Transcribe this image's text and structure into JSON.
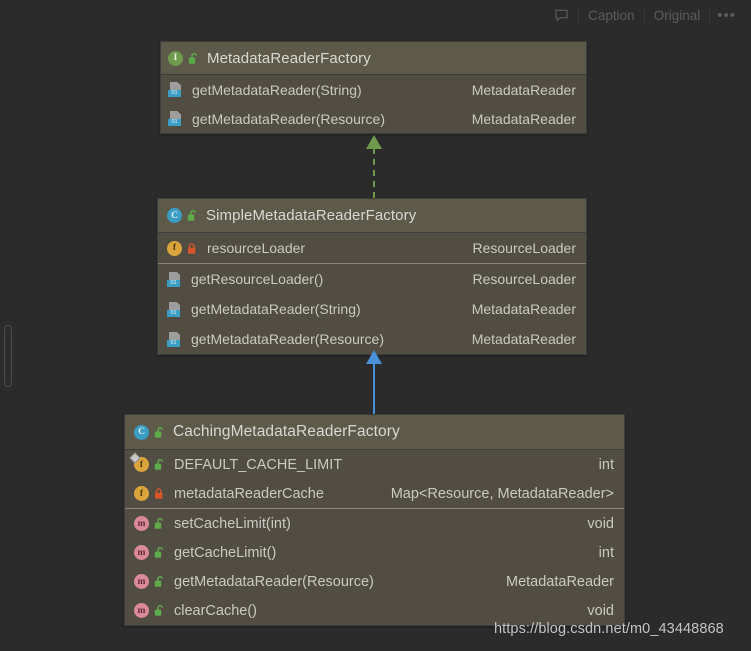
{
  "toolbar": {
    "comment_icon": "speech-bubble-icon",
    "caption_label": "Caption",
    "original_label": "Original",
    "more_label": "•••"
  },
  "watermark": "https://blog.csdn.net/m0_43448868",
  "colors": {
    "canvas": "#2b2b2b",
    "node_header": "#5e5a4a",
    "node_body": "#524d42",
    "interface_icon": "#6f9a4e",
    "class_icon": "#3b9dc4",
    "field_icon": "#d9a43c",
    "method_icon": "#d9899a",
    "public_lock": "#5faa4a",
    "private_lock": "#d4562a",
    "realization_arrow": "#6f9a4e",
    "inheritance_arrow": "#4a90d9"
  },
  "diagram": {
    "type": "uml-class-diagram",
    "nodes": [
      {
        "id": "MetadataReaderFactory",
        "kind": "interface",
        "kind_icon": "interface-icon",
        "access": "public",
        "access_icon": "unlock-icon",
        "title": "MetadataReaderFactory",
        "sections": [
          {
            "name": "methods",
            "members": [
              {
                "kind_icon": "abstract-method-icon",
                "access_icon": "",
                "name": "getMetadataReader(String)",
                "type": "MetadataReader"
              },
              {
                "kind_icon": "abstract-method-icon",
                "access_icon": "",
                "name": "getMetadataReader(Resource)",
                "type": "MetadataReader"
              }
            ]
          }
        ]
      },
      {
        "id": "SimpleMetadataReaderFactory",
        "kind": "class",
        "kind_icon": "class-icon",
        "access": "public",
        "access_icon": "unlock-icon",
        "title": "SimpleMetadataReaderFactory",
        "sections": [
          {
            "name": "fields",
            "members": [
              {
                "kind_icon": "field-icon",
                "access_icon": "lock-icon",
                "name": "resourceLoader",
                "type": "ResourceLoader"
              }
            ]
          },
          {
            "name": "methods",
            "members": [
              {
                "kind_icon": "abstract-method-icon",
                "access_icon": "",
                "name": "getResourceLoader()",
                "type": "ResourceLoader"
              },
              {
                "kind_icon": "abstract-method-icon",
                "access_icon": "",
                "name": "getMetadataReader(String)",
                "type": "MetadataReader"
              },
              {
                "kind_icon": "abstract-method-icon",
                "access_icon": "",
                "name": "getMetadataReader(Resource)",
                "type": "MetadataReader"
              }
            ]
          }
        ]
      },
      {
        "id": "CachingMetadataReaderFactory",
        "kind": "class",
        "kind_icon": "class-icon",
        "access": "public",
        "access_icon": "unlock-icon",
        "title": "CachingMetadataReaderFactory",
        "sections": [
          {
            "name": "fields",
            "members": [
              {
                "kind_icon": "static-field-icon",
                "access_icon": "unlock-icon",
                "name": "DEFAULT_CACHE_LIMIT",
                "type": "int"
              },
              {
                "kind_icon": "field-icon",
                "access_icon": "lock-icon",
                "name": "metadataReaderCache",
                "type": "Map<Resource, MetadataReader>"
              }
            ]
          },
          {
            "name": "methods",
            "members": [
              {
                "kind_icon": "method-icon",
                "access_icon": "unlock-icon",
                "name": "setCacheLimit(int)",
                "type": "void"
              },
              {
                "kind_icon": "method-icon",
                "access_icon": "unlock-icon",
                "name": "getCacheLimit()",
                "type": "int"
              },
              {
                "kind_icon": "method-icon",
                "access_icon": "unlock-icon",
                "name": "getMetadataReader(Resource)",
                "type": "MetadataReader"
              },
              {
                "kind_icon": "method-icon",
                "access_icon": "unlock-icon",
                "name": "clearCache()",
                "type": "void"
              }
            ]
          }
        ]
      }
    ],
    "edges": [
      {
        "from": "SimpleMetadataReaderFactory",
        "to": "MetadataReaderFactory",
        "relation": "realization",
        "style": "dashed",
        "color": "#6f9a4e"
      },
      {
        "from": "CachingMetadataReaderFactory",
        "to": "SimpleMetadataReaderFactory",
        "relation": "generalization",
        "style": "solid",
        "color": "#4a90d9"
      }
    ]
  }
}
